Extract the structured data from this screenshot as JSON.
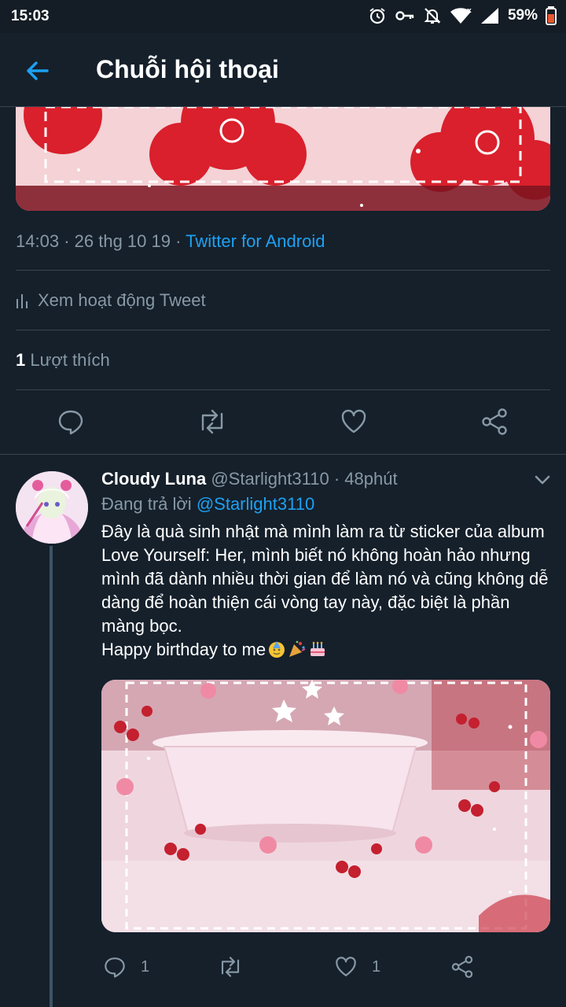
{
  "status_bar": {
    "time": "15:03",
    "battery": "59%"
  },
  "app_bar": {
    "title": "Chuỗi hội thoại"
  },
  "main_tweet": {
    "time": "14:03",
    "date": "26 thg 10 19",
    "source": "Twitter for Android",
    "view_activity": "Xem hoạt động Tweet",
    "likes_count": "1",
    "likes_label": "Lượt thích"
  },
  "reply_tweet": {
    "display_name": "Cloudy Luna",
    "handle": "@Starlight3110",
    "time_ago": "48phút",
    "replying_label": "Đang trả lời",
    "replying_to": "@Starlight3110",
    "text": "Đây là quà sinh nhật mà mình làm ra từ sticker của album Love Yourself: Her, mình biết nó không hoàn hảo nhưng mình đã dành nhiều thời gian để làm nó và cũng không dễ dàng để hoàn thiện cái vòng tay này, đặc biệt là phần màng bọc.\nHappy birthday to me",
    "reply_count": "1",
    "like_count": "1"
  },
  "icons": {
    "back": "arrow-left-icon",
    "reply": "reply-icon",
    "retweet": "retweet-icon",
    "like": "heart-icon",
    "share": "share-icon",
    "chevron": "chevron-down-icon"
  },
  "colors": {
    "background": "#15202b",
    "accent": "#1da1f2",
    "muted": "#8899a6",
    "divider": "#38444d"
  }
}
